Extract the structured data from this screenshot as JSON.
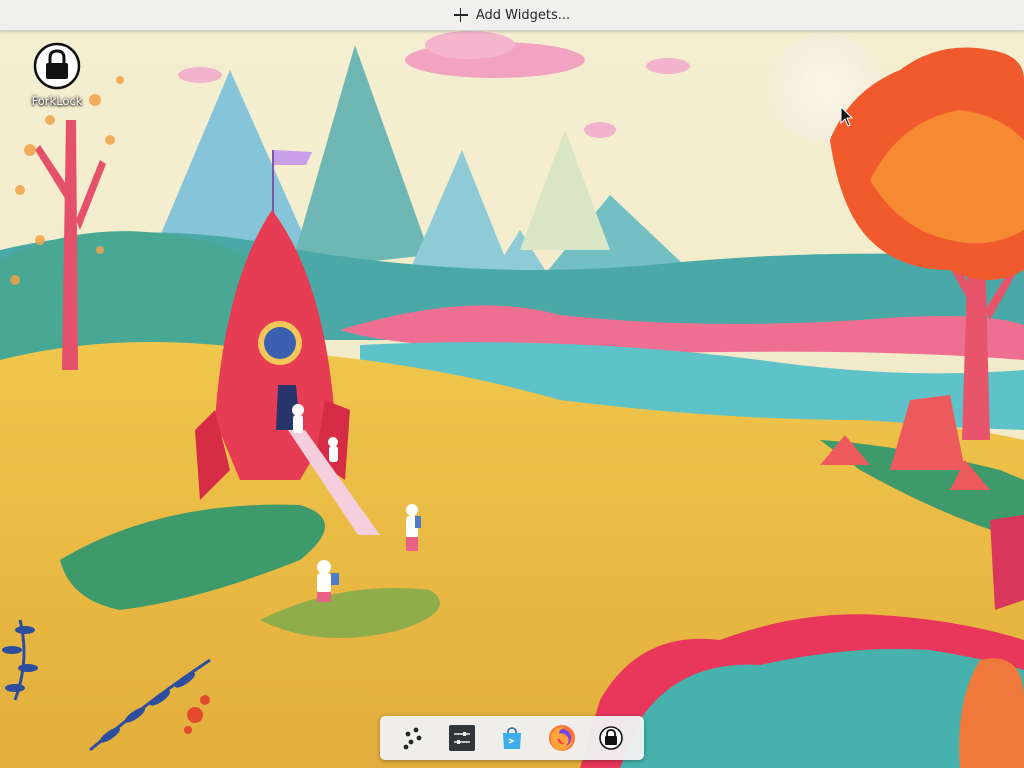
{
  "topbar": {
    "add_widgets_label": "Add Widgets..."
  },
  "desktop_icons": [
    {
      "label": "ForkLock",
      "icon": "lock-icon"
    }
  ],
  "panel": {
    "items": [
      {
        "name": "application-launcher",
        "icon": "launcher-dots-icon"
      },
      {
        "name": "system-settings",
        "icon": "settings-sliders-icon"
      },
      {
        "name": "discover-store",
        "icon": "shopping-bag-icon"
      },
      {
        "name": "firefox",
        "icon": "firefox-icon"
      },
      {
        "name": "forklock",
        "icon": "lock-icon"
      }
    ]
  },
  "colors": {
    "panel_bg": "#eff0f1",
    "accent": "#3daee9",
    "sky": "#f3ecd0",
    "rocket": "#e8344f",
    "grass": "#eec44a",
    "tree": "#f0542d"
  }
}
